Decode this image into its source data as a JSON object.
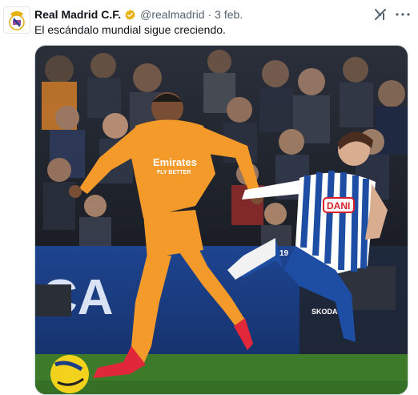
{
  "tweet": {
    "author_name": "Real Madrid C.F.",
    "handle": "@realmadrid",
    "separator": "·",
    "date": "3 feb.",
    "text": "El escándalo mundial sigue creciendo.",
    "grok_label": "x/",
    "more_label": "···"
  },
  "media": {
    "shirt_sponsor_left": "Emirates",
    "shirt_sponsor_left_sub": "FLY BETTER",
    "shirt_sponsor_right": "DANI",
    "shorts_sponsor": "SKODA",
    "board_text": "CA",
    "player_number": "19"
  },
  "colors": {
    "verified_badge": "#e8b10c",
    "madrid_orange": "#f49a2a",
    "espanyol_blue": "#1d4ea3",
    "board_blue": "#1b3e86",
    "pitch_green": "#3d7a2a"
  }
}
